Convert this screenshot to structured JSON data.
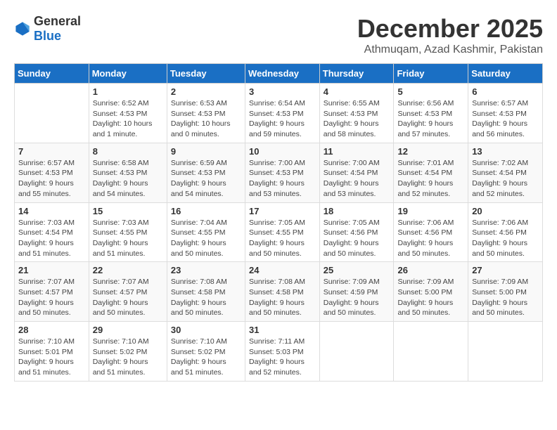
{
  "header": {
    "logo_general": "General",
    "logo_blue": "Blue",
    "month_title": "December 2025",
    "subtitle": "Athmuqam, Azad Kashmir, Pakistan"
  },
  "days_of_week": [
    "Sunday",
    "Monday",
    "Tuesday",
    "Wednesday",
    "Thursday",
    "Friday",
    "Saturday"
  ],
  "weeks": [
    [
      {
        "day": "",
        "info": ""
      },
      {
        "day": "1",
        "info": "Sunrise: 6:52 AM\nSunset: 4:53 PM\nDaylight: 10 hours\nand 1 minute."
      },
      {
        "day": "2",
        "info": "Sunrise: 6:53 AM\nSunset: 4:53 PM\nDaylight: 10 hours\nand 0 minutes."
      },
      {
        "day": "3",
        "info": "Sunrise: 6:54 AM\nSunset: 4:53 PM\nDaylight: 9 hours\nand 59 minutes."
      },
      {
        "day": "4",
        "info": "Sunrise: 6:55 AM\nSunset: 4:53 PM\nDaylight: 9 hours\nand 58 minutes."
      },
      {
        "day": "5",
        "info": "Sunrise: 6:56 AM\nSunset: 4:53 PM\nDaylight: 9 hours\nand 57 minutes."
      },
      {
        "day": "6",
        "info": "Sunrise: 6:57 AM\nSunset: 4:53 PM\nDaylight: 9 hours\nand 56 minutes."
      }
    ],
    [
      {
        "day": "7",
        "info": "Sunrise: 6:57 AM\nSunset: 4:53 PM\nDaylight: 9 hours\nand 55 minutes."
      },
      {
        "day": "8",
        "info": "Sunrise: 6:58 AM\nSunset: 4:53 PM\nDaylight: 9 hours\nand 54 minutes."
      },
      {
        "day": "9",
        "info": "Sunrise: 6:59 AM\nSunset: 4:53 PM\nDaylight: 9 hours\nand 54 minutes."
      },
      {
        "day": "10",
        "info": "Sunrise: 7:00 AM\nSunset: 4:53 PM\nDaylight: 9 hours\nand 53 minutes."
      },
      {
        "day": "11",
        "info": "Sunrise: 7:00 AM\nSunset: 4:54 PM\nDaylight: 9 hours\nand 53 minutes."
      },
      {
        "day": "12",
        "info": "Sunrise: 7:01 AM\nSunset: 4:54 PM\nDaylight: 9 hours\nand 52 minutes."
      },
      {
        "day": "13",
        "info": "Sunrise: 7:02 AM\nSunset: 4:54 PM\nDaylight: 9 hours\nand 52 minutes."
      }
    ],
    [
      {
        "day": "14",
        "info": "Sunrise: 7:03 AM\nSunset: 4:54 PM\nDaylight: 9 hours\nand 51 minutes."
      },
      {
        "day": "15",
        "info": "Sunrise: 7:03 AM\nSunset: 4:55 PM\nDaylight: 9 hours\nand 51 minutes."
      },
      {
        "day": "16",
        "info": "Sunrise: 7:04 AM\nSunset: 4:55 PM\nDaylight: 9 hours\nand 50 minutes."
      },
      {
        "day": "17",
        "info": "Sunrise: 7:05 AM\nSunset: 4:55 PM\nDaylight: 9 hours\nand 50 minutes."
      },
      {
        "day": "18",
        "info": "Sunrise: 7:05 AM\nSunset: 4:56 PM\nDaylight: 9 hours\nand 50 minutes."
      },
      {
        "day": "19",
        "info": "Sunrise: 7:06 AM\nSunset: 4:56 PM\nDaylight: 9 hours\nand 50 minutes."
      },
      {
        "day": "20",
        "info": "Sunrise: 7:06 AM\nSunset: 4:56 PM\nDaylight: 9 hours\nand 50 minutes."
      }
    ],
    [
      {
        "day": "21",
        "info": "Sunrise: 7:07 AM\nSunset: 4:57 PM\nDaylight: 9 hours\nand 50 minutes."
      },
      {
        "day": "22",
        "info": "Sunrise: 7:07 AM\nSunset: 4:57 PM\nDaylight: 9 hours\nand 50 minutes."
      },
      {
        "day": "23",
        "info": "Sunrise: 7:08 AM\nSunset: 4:58 PM\nDaylight: 9 hours\nand 50 minutes."
      },
      {
        "day": "24",
        "info": "Sunrise: 7:08 AM\nSunset: 4:58 PM\nDaylight: 9 hours\nand 50 minutes."
      },
      {
        "day": "25",
        "info": "Sunrise: 7:09 AM\nSunset: 4:59 PM\nDaylight: 9 hours\nand 50 minutes."
      },
      {
        "day": "26",
        "info": "Sunrise: 7:09 AM\nSunset: 5:00 PM\nDaylight: 9 hours\nand 50 minutes."
      },
      {
        "day": "27",
        "info": "Sunrise: 7:09 AM\nSunset: 5:00 PM\nDaylight: 9 hours\nand 50 minutes."
      }
    ],
    [
      {
        "day": "28",
        "info": "Sunrise: 7:10 AM\nSunset: 5:01 PM\nDaylight: 9 hours\nand 51 minutes."
      },
      {
        "day": "29",
        "info": "Sunrise: 7:10 AM\nSunset: 5:02 PM\nDaylight: 9 hours\nand 51 minutes."
      },
      {
        "day": "30",
        "info": "Sunrise: 7:10 AM\nSunset: 5:02 PM\nDaylight: 9 hours\nand 51 minutes."
      },
      {
        "day": "31",
        "info": "Sunrise: 7:11 AM\nSunset: 5:03 PM\nDaylight: 9 hours\nand 52 minutes."
      },
      {
        "day": "",
        "info": ""
      },
      {
        "day": "",
        "info": ""
      },
      {
        "day": "",
        "info": ""
      }
    ]
  ]
}
